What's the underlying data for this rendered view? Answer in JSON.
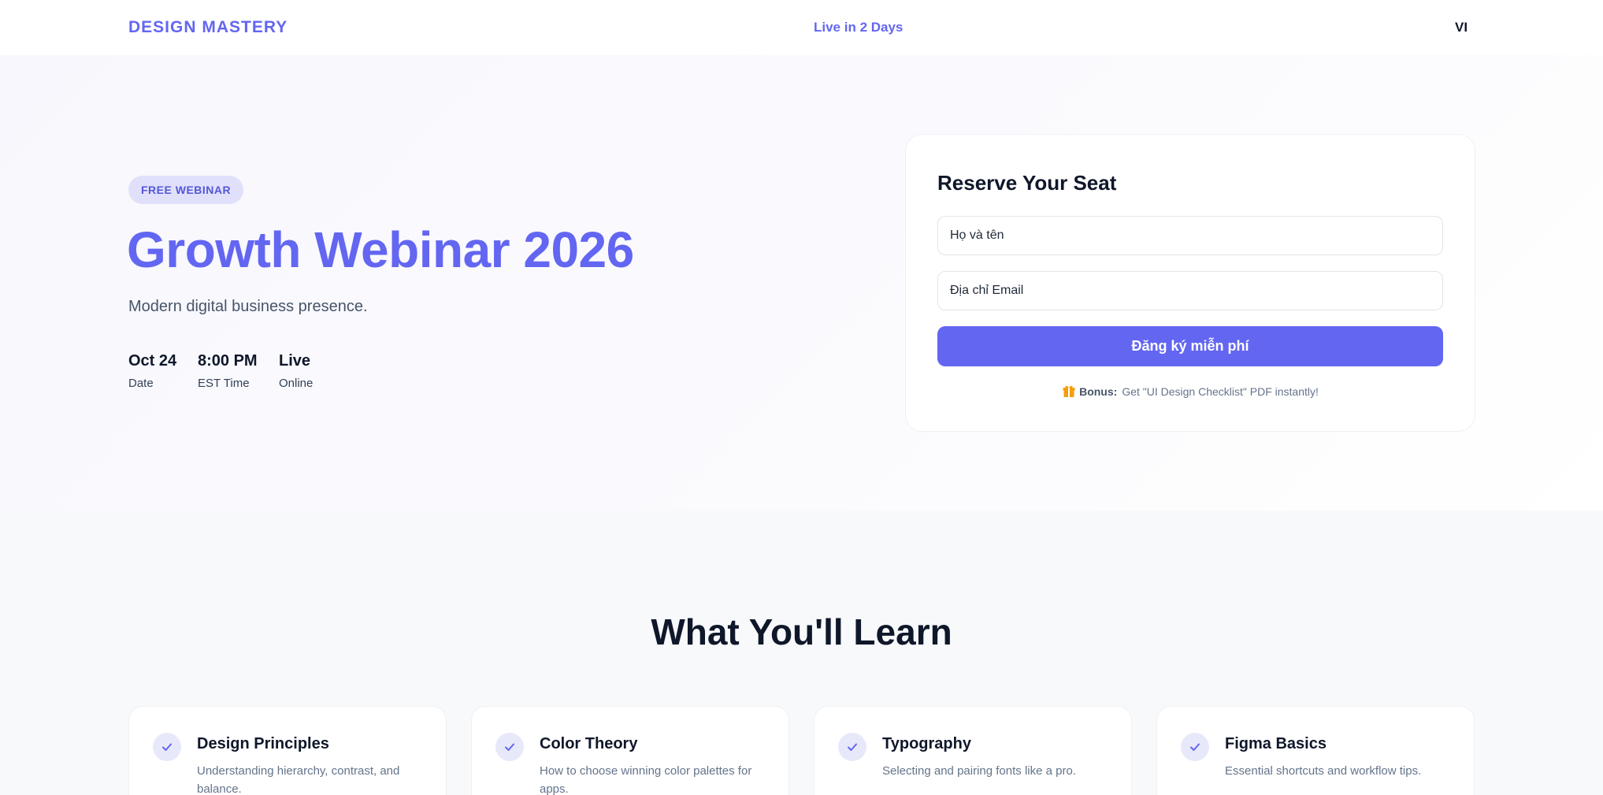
{
  "header": {
    "brand": "DESIGN MASTERY",
    "countdown": "Live in 2 Days",
    "language": "VI"
  },
  "hero": {
    "badge": "FREE WEBINAR",
    "title": "Growth Webinar 2026",
    "subtitle": "Modern digital business presence.",
    "meta": [
      {
        "value": "Oct 24",
        "label": "Date"
      },
      {
        "value": "8:00 PM",
        "label": "EST Time"
      },
      {
        "value": "Live",
        "label": "Online"
      }
    ]
  },
  "form": {
    "title": "Reserve Your Seat",
    "name_placeholder": "Họ và tên",
    "email_placeholder": "Địa chỉ Email",
    "submit_label": "Đăng ký miễn phí",
    "bonus_label": "Bonus:",
    "bonus_text": "Get \"UI Design Checklist\" PDF instantly!",
    "bonus_icon": "gift-icon"
  },
  "learn": {
    "title": "What You'll Learn",
    "items": [
      {
        "title": "Design Principles",
        "description": "Understanding hierarchy, contrast, and balance.",
        "icon": "check-icon"
      },
      {
        "title": "Color Theory",
        "description": "How to choose winning color palettes for apps.",
        "icon": "check-icon"
      },
      {
        "title": "Typography",
        "description": "Selecting and pairing fonts like a pro.",
        "icon": "check-icon"
      },
      {
        "title": "Figma Basics",
        "description": "Essential shortcuts and workflow tips.",
        "icon": "check-icon"
      }
    ]
  },
  "colors": {
    "accent": "#6366f1",
    "badge_bg": "#e0e0fb",
    "gift": "#f59e0b",
    "heading": "#0f172a",
    "muted": "#64748b"
  }
}
